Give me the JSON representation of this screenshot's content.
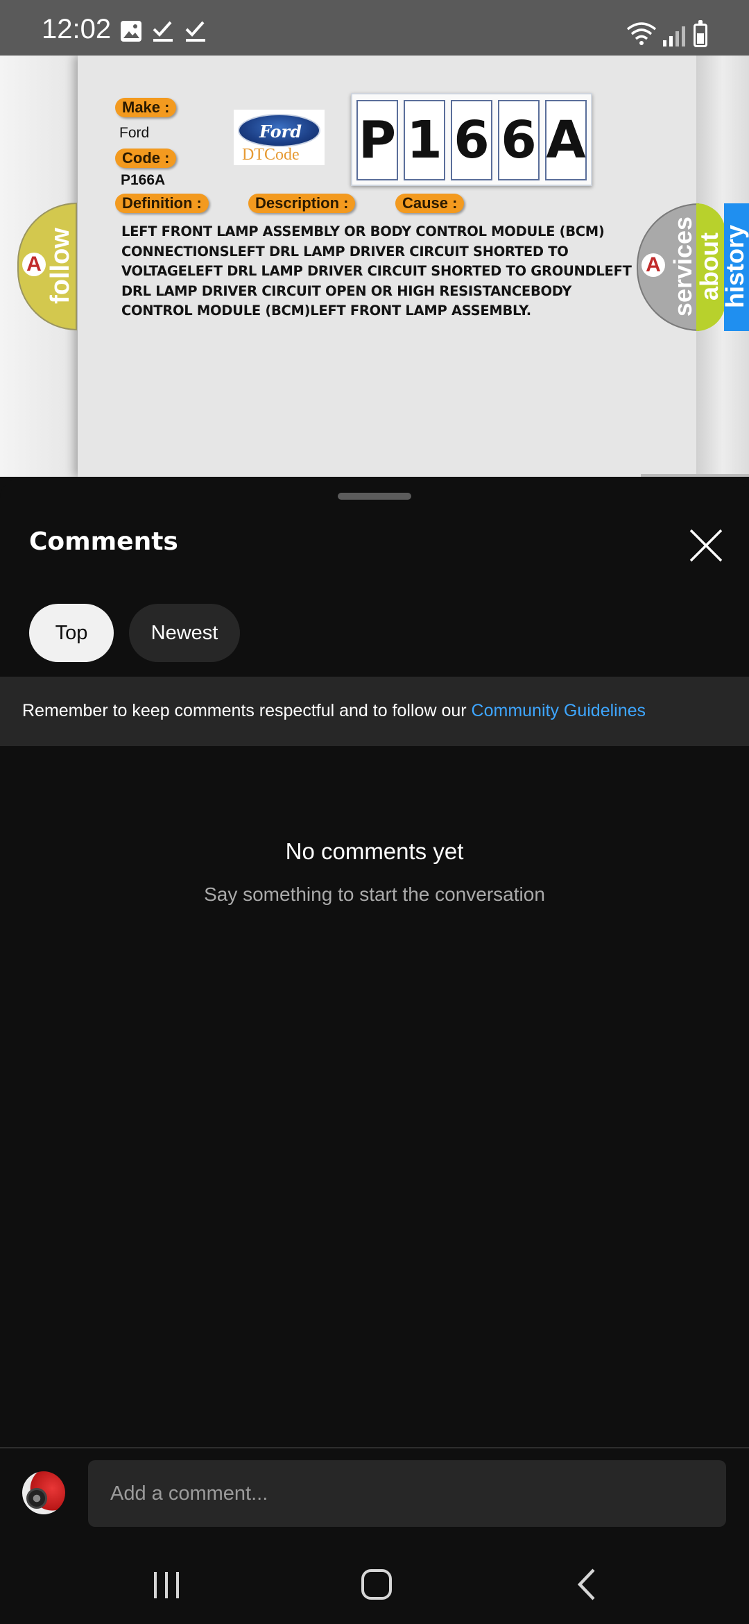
{
  "status_bar": {
    "time": "12:02",
    "left_icons": [
      "image-icon",
      "check-icon",
      "check-icon"
    ],
    "right_icons": [
      "wifi-icon",
      "signal-icon",
      "battery-icon"
    ]
  },
  "video": {
    "make_label": "Make :",
    "make_value": "Ford",
    "code_label": "Code :",
    "code_value": "P166A",
    "definition_label": "Definition :",
    "description_label": "Description :",
    "cause_label": "Cause :",
    "logo_word": "Ford",
    "logo_subtitle": "DTCode",
    "code_characters": [
      "P",
      "1",
      "6",
      "6",
      "A"
    ],
    "definition_text": "LEFT FRONT LAMP ASSEMBLY OR BODY CONTROL MODULE (BCM) CONNECTIONSLEFT DRL LAMP DRIVER CIRCUIT SHORTED TO VOLTAGELEFT DRL LAMP DRIVER CIRCUIT SHORTED TO GROUNDLEFT DRL LAMP DRIVER CIRCUIT OPEN OR HIGH RESISTANCEBODY CONTROL MODULE (BCM)LEFT FRONT LAMP ASSEMBLY.",
    "badge_letter": "A",
    "tabs": {
      "follow": "follow",
      "services": "services",
      "about": "about",
      "history": "history"
    },
    "colors": {
      "label_orange": "#f39a1f",
      "follow_tab": "#d3c84e",
      "about_tab": "#b8d12c",
      "history_tab": "#1f8ff0"
    }
  },
  "comments": {
    "title": "Comments",
    "sort_chips": [
      "Top",
      "Newest"
    ],
    "selected_sort": "Top",
    "guidelines_text": "Remember to keep comments respectful and to follow our ",
    "guidelines_link": "Community Guidelines",
    "empty_title": "No comments yet",
    "empty_subtitle": "Say something to start the conversation",
    "input_placeholder": "Add a comment..."
  },
  "colors": {
    "sheet_background": "#0f0f0f",
    "link": "#3ea6ff",
    "chip_selected": "#f1f1f1",
    "chip_default": "#272727"
  },
  "nav": {
    "icons": [
      "recents-icon",
      "home-icon",
      "back-icon"
    ]
  }
}
